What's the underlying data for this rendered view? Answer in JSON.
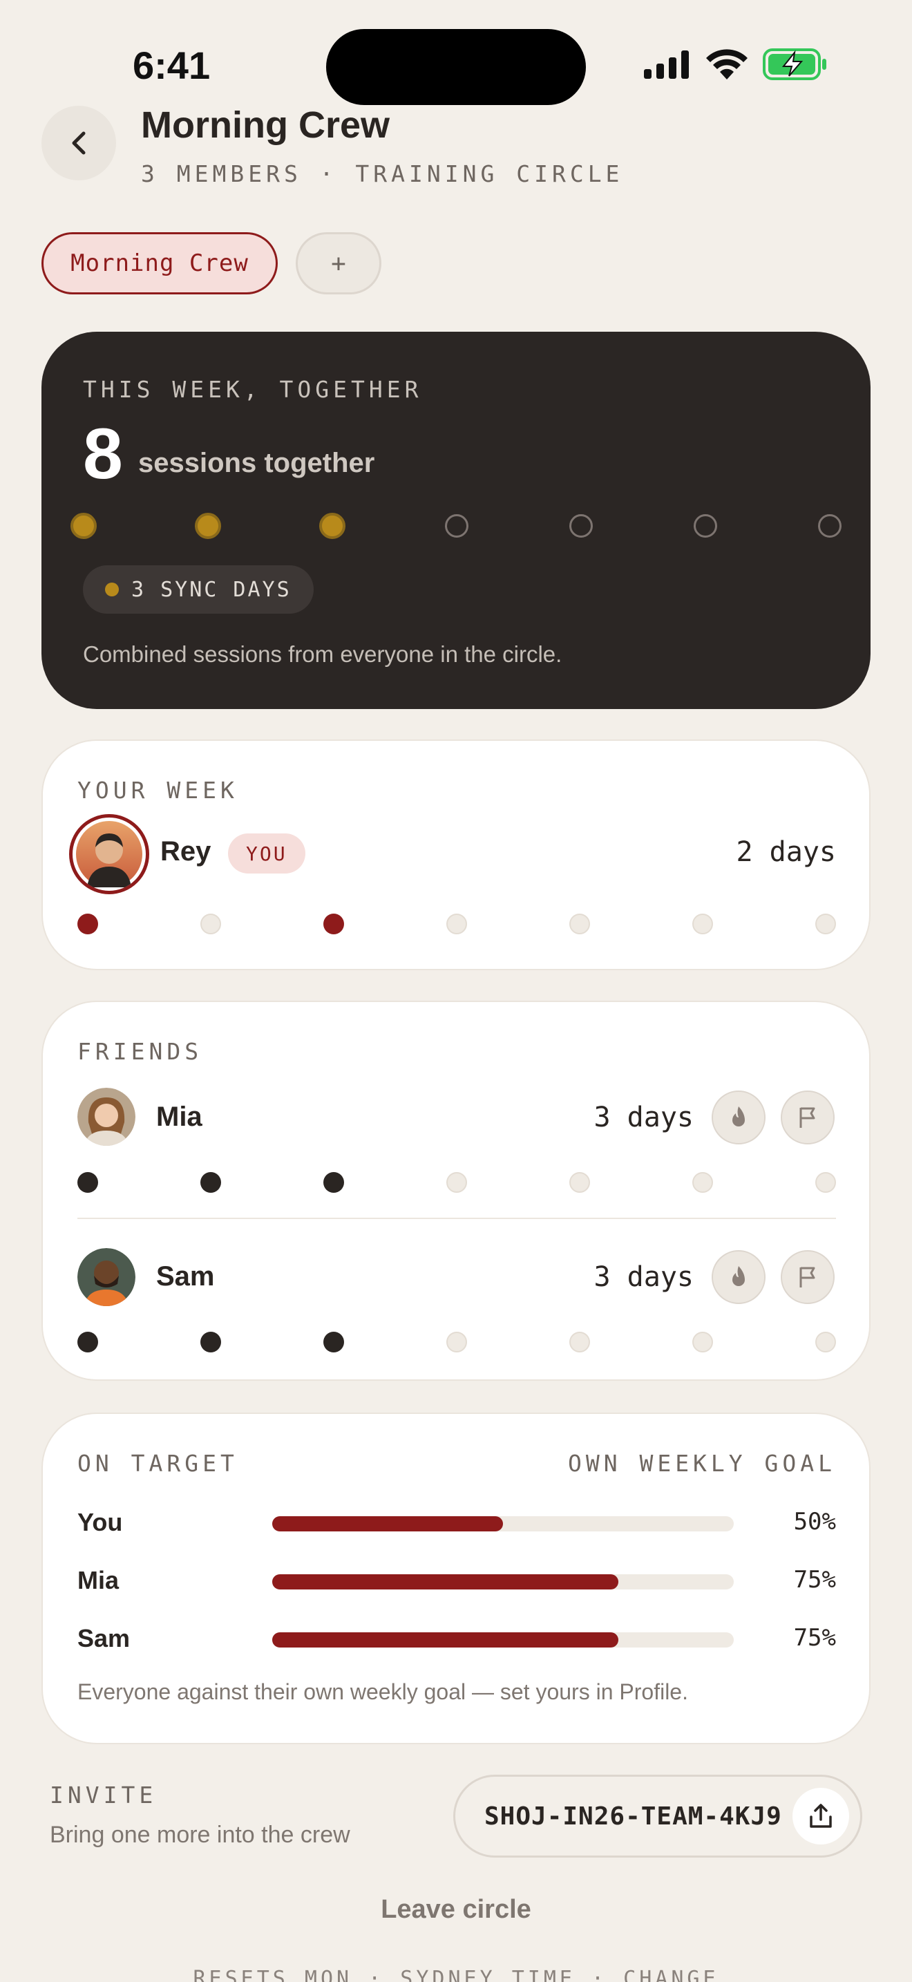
{
  "status": {
    "time": "6:41"
  },
  "header": {
    "title": "Morning Crew",
    "subtitle": "3 MEMBERS · TRAINING CIRCLE"
  },
  "chips": {
    "active": "Morning Crew",
    "add": "+"
  },
  "together": {
    "label": "THIS WEEK, TOGETHER",
    "count": "8",
    "count_label": "sessions together",
    "days_filled": [
      true,
      true,
      true,
      false,
      false,
      false,
      false
    ],
    "sync_label": "3 SYNC DAYS",
    "footnote": "Combined sessions from everyone in the circle."
  },
  "your_week": {
    "label": "YOUR WEEK",
    "name": "Rey",
    "badge": "YOU",
    "days": "2 days",
    "week": [
      true,
      false,
      true,
      false,
      false,
      false,
      false
    ]
  },
  "friends": {
    "label": "FRIENDS",
    "list": [
      {
        "name": "Mia",
        "days": "3 days",
        "week": [
          true,
          true,
          true,
          false,
          false,
          false,
          false
        ]
      },
      {
        "name": "Sam",
        "days": "3 days",
        "week": [
          true,
          true,
          true,
          false,
          false,
          false,
          false
        ]
      }
    ]
  },
  "target": {
    "label": "ON TARGET",
    "right_label": "OWN WEEKLY GOAL",
    "rows": [
      {
        "name": "You",
        "value": 0.5,
        "pct": "50%"
      },
      {
        "name": "Mia",
        "value": 0.75,
        "pct": "75%"
      },
      {
        "name": "Sam",
        "value": 0.75,
        "pct": "75%"
      }
    ],
    "footnote": "Everyone against their own weekly goal — set yours in Profile."
  },
  "invite": {
    "label": "INVITE",
    "sub": "Bring one more into the crew",
    "code": "SHOJ-IN26-TEAM-4KJ9"
  },
  "leave": "Leave circle",
  "resets": "RESETS MON · SYDNEY TIME · CHANGE",
  "colors": {
    "accent": "#8E1B1B",
    "gold": "#B88A1B",
    "dark_card": "#2B2624",
    "background": "#F3EFE9"
  }
}
